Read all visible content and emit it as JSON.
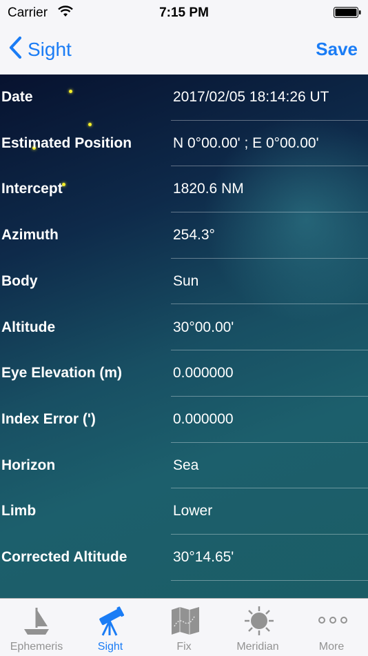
{
  "status_bar": {
    "carrier": "Carrier",
    "time": "7:15 PM"
  },
  "nav": {
    "back_label": "Sight",
    "save_label": "Save"
  },
  "rows": [
    {
      "label": "Date",
      "value": "2017/02/05 18:14:26 UT"
    },
    {
      "label": "Estimated Position",
      "value": "N 0°00.00' ; E 0°00.00'"
    },
    {
      "label": "Intercept",
      "value": "1820.6 NM"
    },
    {
      "label": "Azimuth",
      "value": "254.3°"
    },
    {
      "label": "Body",
      "value": "Sun"
    },
    {
      "label": "Altitude",
      "value": "30°00.00'"
    },
    {
      "label": "Eye Elevation (m)",
      "value": "0.000000"
    },
    {
      "label": "Index Error (')",
      "value": "0.000000"
    },
    {
      "label": "Horizon",
      "value": "Sea"
    },
    {
      "label": "Limb",
      "value": "Lower"
    },
    {
      "label": "Corrected Altitude",
      "value": "30°14.65'"
    }
  ],
  "tabs": [
    {
      "label": "Ephemeris",
      "icon": "boat-icon",
      "active": false
    },
    {
      "label": "Sight",
      "icon": "telescope-icon",
      "active": true
    },
    {
      "label": "Fix",
      "icon": "map-icon",
      "active": false
    },
    {
      "label": "Meridian",
      "icon": "sun-icon",
      "active": false
    },
    {
      "label": "More",
      "icon": "more-icon",
      "active": false
    }
  ],
  "colors": {
    "accent": "#1a7cf5",
    "inactive_tab": "#929292",
    "star": "#f5ef2a"
  }
}
